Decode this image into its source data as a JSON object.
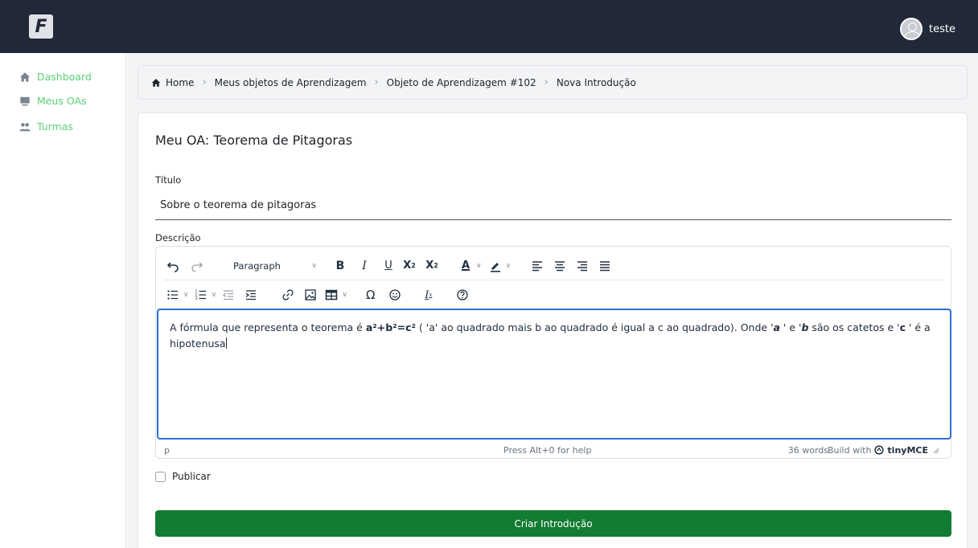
{
  "topbar": {
    "logo_letter": "F",
    "user_name": "teste"
  },
  "sidebar": {
    "items": [
      {
        "label": "Dashboard",
        "icon": "home-icon"
      },
      {
        "label": "Meus OAs",
        "icon": "monitor-icon"
      },
      {
        "label": "Turmas",
        "icon": "users-icon"
      }
    ]
  },
  "breadcrumb": {
    "items": [
      "Home",
      "Meus objetos de Aprendizagem",
      "Objeto de Aprendizagem #102",
      "Nova Introdução"
    ]
  },
  "card": {
    "title": "Meu OA: Teorema de Pitagoras",
    "titulo_label": "Título",
    "titulo_value": "Sobre o teorema de pitagoras",
    "descricao_label": "Descrição"
  },
  "editor": {
    "block_format": "Paragraph",
    "content": {
      "part1": "A fórmula que representa o teorema é ",
      "formula": "a²+b²=c²",
      "part2": " ( 'a' ao quadrado mais b ao quadrado é igual a c ao quadrado). Onde '",
      "var_a": "a",
      "part3": " ' e '",
      "var_b": "b",
      "part4": " são os catetos e '",
      "var_c": "c",
      "part5": " ' é a hipotenusa"
    },
    "status_path": "p",
    "status_help": "Press Alt+0 for help",
    "word_count": "36 words",
    "brand_prefix": "Build with",
    "brand_name": "tinyMCE"
  },
  "publicar_label": "Publicar",
  "submit_label": "Criar Introdução",
  "colors": {
    "topbar": "#212938",
    "sidebar_link": "#5ad076",
    "submit": "#127c32",
    "editor_focus": "#2e6fd5"
  }
}
